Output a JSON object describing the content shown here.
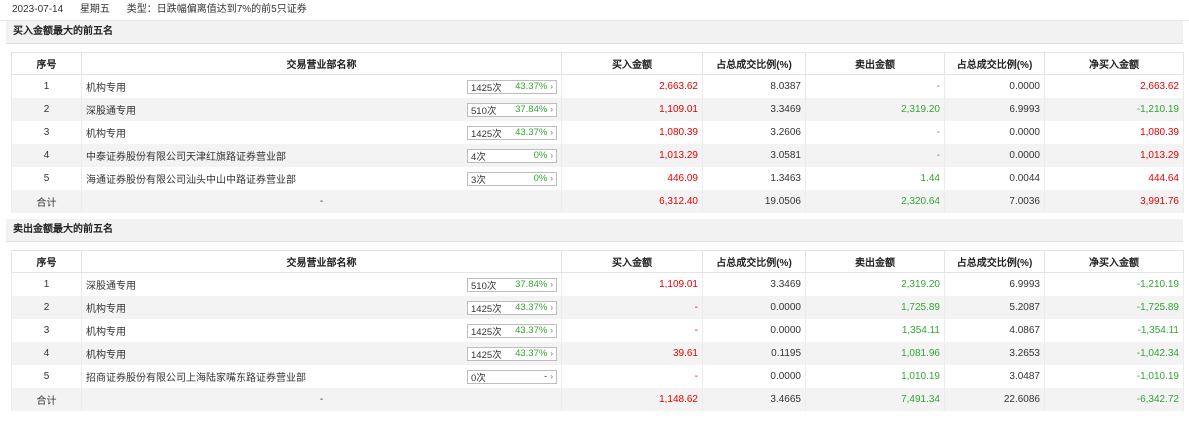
{
  "header": {
    "date": "2023-07-14",
    "weekday": "星期五",
    "type_text": "类型：日跌幅偏离值达到7%的前5只证券"
  },
  "columns": [
    "序号",
    "交易营业部名称",
    "买入金额",
    "占总成交比例(%)",
    "卖出金额",
    "占总成交比例(%)",
    "净买入金额"
  ],
  "buy_section": {
    "title": "买入金额最大的前五名",
    "rows": [
      {
        "no": "1",
        "name": "机构专用",
        "times": "1425次",
        "pct": "43.37%",
        "buy": "2,663.62",
        "buy_ratio": "8.0387",
        "sell": "-",
        "sell_ratio": "0.0000",
        "net": "2,663.62"
      },
      {
        "no": "2",
        "name": "深股通专用",
        "times": "510次",
        "pct": "37.84%",
        "buy": "1,109.01",
        "buy_ratio": "3.3469",
        "sell": "2,319.20",
        "sell_ratio": "6.9993",
        "net": "-1,210.19"
      },
      {
        "no": "3",
        "name": "机构专用",
        "times": "1425次",
        "pct": "43.37%",
        "buy": "1,080.39",
        "buy_ratio": "3.2606",
        "sell": "-",
        "sell_ratio": "0.0000",
        "net": "1,080.39"
      },
      {
        "no": "4",
        "name": "中泰证券股份有限公司天津红旗路证券营业部",
        "times": "4次",
        "pct": "0%",
        "buy": "1,013.29",
        "buy_ratio": "3.0581",
        "sell": "-",
        "sell_ratio": "0.0000",
        "net": "1,013.29"
      },
      {
        "no": "5",
        "name": "海通证券股份有限公司汕头中山中路证券营业部",
        "times": "3次",
        "pct": "0%",
        "buy": "446.09",
        "buy_ratio": "1.3463",
        "sell": "1.44",
        "sell_ratio": "0.0044",
        "net": "444.64"
      }
    ],
    "total": {
      "label": "合计",
      "name": "-",
      "buy": "6,312.40",
      "buy_ratio": "19.0506",
      "sell": "2,320.64",
      "sell_ratio": "7.0036",
      "net": "3,991.76"
    }
  },
  "sell_section": {
    "title": "卖出金额最大的前五名",
    "rows": [
      {
        "no": "1",
        "name": "深股通专用",
        "times": "510次",
        "pct": "37.84%",
        "buy": "1,109.01",
        "buy_ratio": "3.3469",
        "sell": "2,319.20",
        "sell_ratio": "6.9993",
        "net": "-1,210.19"
      },
      {
        "no": "2",
        "name": "机构专用",
        "times": "1425次",
        "pct": "43.37%",
        "buy": "-",
        "buy_ratio": "0.0000",
        "sell": "1,725.89",
        "sell_ratio": "5.2087",
        "net": "-1,725.89"
      },
      {
        "no": "3",
        "name": "机构专用",
        "times": "1425次",
        "pct": "43.37%",
        "buy": "-",
        "buy_ratio": "0.0000",
        "sell": "1,354.11",
        "sell_ratio": "4.0867",
        "net": "-1,354.11"
      },
      {
        "no": "4",
        "name": "机构专用",
        "times": "1425次",
        "pct": "43.37%",
        "buy": "39.61",
        "buy_ratio": "0.1195",
        "sell": "1,081.96",
        "sell_ratio": "3.2653",
        "net": "-1,042.34"
      },
      {
        "no": "5",
        "name": "招商证券股份有限公司上海陆家嘴东路证券营业部",
        "times": "0次",
        "pct": "-",
        "buy": "-",
        "buy_ratio": "0.0000",
        "sell": "1,010.19",
        "sell_ratio": "3.0487",
        "net": "-1,010.19"
      }
    ],
    "total": {
      "label": "合计",
      "name": "-",
      "buy": "1,148.62",
      "buy_ratio": "3.4665",
      "sell": "7,491.34",
      "sell_ratio": "22.6086",
      "net": "-6,342.72"
    }
  },
  "colors": {
    "red": "#e60000",
    "green": "#33a532"
  }
}
